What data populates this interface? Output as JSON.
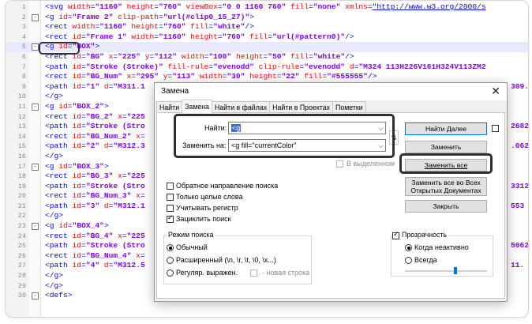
{
  "editor": {
    "lines": [
      {
        "n": "1",
        "segs": [
          [
            "tag",
            "<svg "
          ],
          [
            "attr",
            "width"
          ],
          [
            "tag",
            "="
          ],
          [
            "val",
            "\"1160\""
          ],
          [
            "tag",
            " "
          ],
          [
            "attr",
            "height"
          ],
          [
            "tag",
            "="
          ],
          [
            "val",
            "\"760\""
          ],
          [
            "tag",
            " "
          ],
          [
            "attr",
            "viewBox"
          ],
          [
            "tag",
            "="
          ],
          [
            "val",
            "\"0 0 1160 760\""
          ],
          [
            "tag",
            " "
          ],
          [
            "attr",
            "fill"
          ],
          [
            "tag",
            "="
          ],
          [
            "val",
            "\"none\""
          ],
          [
            "tag",
            " "
          ],
          [
            "attr",
            "xmlns"
          ],
          [
            "tag",
            "="
          ],
          [
            "url",
            "\"http://www.w3.org/2000/s"
          ]
        ]
      },
      {
        "n": "2",
        "fold": "-",
        "segs": [
          [
            "tag",
            "<g "
          ],
          [
            "attr",
            "id"
          ],
          [
            "tag",
            "="
          ],
          [
            "val",
            "\"Frame 2\""
          ],
          [
            "tag",
            " "
          ],
          [
            "attr",
            "clip-path"
          ],
          [
            "tag",
            "="
          ],
          [
            "val",
            "\"url(#clip0_15_27)\""
          ],
          [
            "tag",
            ">"
          ]
        ]
      },
      {
        "n": "3",
        "segs": [
          [
            "tag",
            "<rect "
          ],
          [
            "attr",
            "width"
          ],
          [
            "tag",
            "="
          ],
          [
            "val",
            "\"1160\""
          ],
          [
            "tag",
            " "
          ],
          [
            "attr",
            "height"
          ],
          [
            "tag",
            "="
          ],
          [
            "val",
            "\"760\""
          ],
          [
            "tag",
            " "
          ],
          [
            "attr",
            "fill"
          ],
          [
            "tag",
            "="
          ],
          [
            "val",
            "\"white\""
          ],
          [
            "tag",
            "/>"
          ]
        ]
      },
      {
        "n": "4",
        "segs": [
          [
            "tag",
            "<rect "
          ],
          [
            "attr",
            "id"
          ],
          [
            "tag",
            "="
          ],
          [
            "val",
            "\"Frame 1\""
          ],
          [
            "tag",
            " "
          ],
          [
            "attr",
            "width"
          ],
          [
            "tag",
            "="
          ],
          [
            "val",
            "\"1160\""
          ],
          [
            "tag",
            " "
          ],
          [
            "attr",
            "height"
          ],
          [
            "tag",
            "="
          ],
          [
            "val",
            "\"760\""
          ],
          [
            "tag",
            " "
          ],
          [
            "attr",
            "fill"
          ],
          [
            "tag",
            "="
          ],
          [
            "val",
            "\"url(#pattern0)\""
          ],
          [
            "tag",
            "/>"
          ]
        ]
      },
      {
        "n": "5",
        "fold": "-",
        "hl": true,
        "segs": [
          [
            "tag",
            "<g "
          ],
          [
            "attr",
            "id"
          ],
          [
            "tag",
            "="
          ],
          [
            "val",
            "\"BOX\""
          ],
          [
            "tag",
            ">"
          ]
        ]
      },
      {
        "n": "6",
        "segs": [
          [
            "tag",
            "<rect "
          ],
          [
            "attr",
            "id"
          ],
          [
            "tag",
            "="
          ],
          [
            "val",
            "\"BG\""
          ],
          [
            "tag",
            " "
          ],
          [
            "attr",
            "x"
          ],
          [
            "tag",
            "="
          ],
          [
            "val",
            "\"225\""
          ],
          [
            "tag",
            " "
          ],
          [
            "attr",
            "y"
          ],
          [
            "tag",
            "="
          ],
          [
            "val",
            "\"112\""
          ],
          [
            "tag",
            " "
          ],
          [
            "attr",
            "width"
          ],
          [
            "tag",
            "="
          ],
          [
            "val",
            "\"100\""
          ],
          [
            "tag",
            " "
          ],
          [
            "attr",
            "height"
          ],
          [
            "tag",
            "="
          ],
          [
            "val",
            "\"50\""
          ],
          [
            "tag",
            " "
          ],
          [
            "attr",
            "fill"
          ],
          [
            "tag",
            "="
          ],
          [
            "val",
            "\"white\""
          ],
          [
            "tag",
            "/>"
          ]
        ]
      },
      {
        "n": "7",
        "segs": [
          [
            "tag",
            "<path "
          ],
          [
            "attr",
            "id"
          ],
          [
            "tag",
            "="
          ],
          [
            "val",
            "\"Stroke (Stroke)\""
          ],
          [
            "tag",
            " "
          ],
          [
            "attr",
            "fill-rule"
          ],
          [
            "tag",
            "="
          ],
          [
            "val",
            "\"evenodd\""
          ],
          [
            "tag",
            " "
          ],
          [
            "attr",
            "clip-rule"
          ],
          [
            "tag",
            "="
          ],
          [
            "val",
            "\"evenodd\""
          ],
          [
            "tag",
            " "
          ],
          [
            "attr",
            "d"
          ],
          [
            "tag",
            "="
          ],
          [
            "val",
            "\"M324 113H226V161H324V113ZM2"
          ]
        ]
      },
      {
        "n": "8",
        "segs": [
          [
            "tag",
            "<rect "
          ],
          [
            "attr",
            "id"
          ],
          [
            "tag",
            "="
          ],
          [
            "val",
            "\"BG_Num\""
          ],
          [
            "tag",
            " "
          ],
          [
            "attr",
            "x"
          ],
          [
            "tag",
            "="
          ],
          [
            "val",
            "\"295\""
          ],
          [
            "tag",
            " "
          ],
          [
            "attr",
            "y"
          ],
          [
            "tag",
            "="
          ],
          [
            "val",
            "\"113\""
          ],
          [
            "tag",
            " "
          ],
          [
            "attr",
            "width"
          ],
          [
            "tag",
            "="
          ],
          [
            "val",
            "\"30\""
          ],
          [
            "tag",
            " "
          ],
          [
            "attr",
            "height"
          ],
          [
            "tag",
            "="
          ],
          [
            "val",
            "\"22\""
          ],
          [
            "tag",
            " "
          ],
          [
            "attr",
            "fill"
          ],
          [
            "tag",
            "="
          ],
          [
            "val",
            "\"#555555\""
          ],
          [
            "tag",
            "/>"
          ]
        ]
      },
      {
        "n": "9",
        "segs": [
          [
            "tag",
            "<path "
          ],
          [
            "attr",
            "id"
          ],
          [
            "tag",
            "="
          ],
          [
            "val",
            "\"1\""
          ],
          [
            "tag",
            " "
          ],
          [
            "attr",
            "d"
          ],
          [
            "tag",
            "="
          ],
          [
            "val",
            "\"M311.1"
          ]
        ],
        "tail": "309."
      },
      {
        "n": "10",
        "segs": [
          [
            "tag",
            "</g>"
          ]
        ]
      },
      {
        "n": "11",
        "fold": "-",
        "segs": [
          [
            "tag",
            "<g "
          ],
          [
            "attr",
            "id"
          ],
          [
            "tag",
            "="
          ],
          [
            "val",
            "\"BOX_2\""
          ],
          [
            "tag",
            ">"
          ]
        ]
      },
      {
        "n": "12",
        "segs": [
          [
            "tag",
            "<rect "
          ],
          [
            "attr",
            "id"
          ],
          [
            "tag",
            "="
          ],
          [
            "val",
            "\"BG_2\""
          ],
          [
            "tag",
            " "
          ],
          [
            "attr",
            "x"
          ],
          [
            "tag",
            "="
          ],
          [
            "val",
            "\"225"
          ]
        ]
      },
      {
        "n": "13",
        "segs": [
          [
            "tag",
            "<path "
          ],
          [
            "attr",
            "id"
          ],
          [
            "tag",
            "="
          ],
          [
            "val",
            "\"Stroke (Stro"
          ]
        ],
        "tail": "2682"
      },
      {
        "n": "14",
        "segs": [
          [
            "tag",
            "<rect "
          ],
          [
            "attr",
            "id"
          ],
          [
            "tag",
            "="
          ],
          [
            "val",
            "\"BG_Num_2\""
          ],
          [
            "tag",
            " "
          ],
          [
            "attr",
            "x"
          ],
          [
            "tag",
            "="
          ]
        ]
      },
      {
        "n": "15",
        "segs": [
          [
            "tag",
            "<path "
          ],
          [
            "attr",
            "id"
          ],
          [
            "tag",
            "="
          ],
          [
            "val",
            "\"2\""
          ],
          [
            "tag",
            " "
          ],
          [
            "attr",
            "d"
          ],
          [
            "tag",
            "="
          ],
          [
            "val",
            "\"M312.3"
          ]
        ],
        "tail": ".062"
      },
      {
        "n": "16",
        "segs": [
          [
            "tag",
            "</g>"
          ]
        ]
      },
      {
        "n": "17",
        "fold": "-",
        "segs": [
          [
            "tag",
            "<g "
          ],
          [
            "attr",
            "id"
          ],
          [
            "tag",
            "="
          ],
          [
            "val",
            "\"BOX_3\""
          ],
          [
            "tag",
            ">"
          ]
        ]
      },
      {
        "n": "18",
        "segs": [
          [
            "tag",
            "<rect "
          ],
          [
            "attr",
            "id"
          ],
          [
            "tag",
            "="
          ],
          [
            "val",
            "\"BG_3\""
          ],
          [
            "tag",
            " "
          ],
          [
            "attr",
            "x"
          ],
          [
            "tag",
            "="
          ],
          [
            "val",
            "\"225"
          ]
        ]
      },
      {
        "n": "19",
        "segs": [
          [
            "tag",
            "<path "
          ],
          [
            "attr",
            "id"
          ],
          [
            "tag",
            "="
          ],
          [
            "val",
            "\"Stroke (Stro"
          ]
        ],
        "tail": "3312"
      },
      {
        "n": "20",
        "segs": [
          [
            "tag",
            "<rect "
          ],
          [
            "attr",
            "id"
          ],
          [
            "tag",
            "="
          ],
          [
            "val",
            "\"BG_Num_3\""
          ],
          [
            "tag",
            " "
          ],
          [
            "attr",
            "x"
          ],
          [
            "tag",
            "="
          ]
        ]
      },
      {
        "n": "21",
        "segs": [
          [
            "tag",
            "<path "
          ],
          [
            "attr",
            "id"
          ],
          [
            "tag",
            "="
          ],
          [
            "val",
            "\"3\""
          ],
          [
            "tag",
            " "
          ],
          [
            "attr",
            "d"
          ],
          [
            "tag",
            "="
          ],
          [
            "val",
            "\"M312.1"
          ]
        ],
        "tail": "553"
      },
      {
        "n": "22",
        "segs": [
          [
            "tag",
            "</g>"
          ]
        ]
      },
      {
        "n": "23",
        "fold": "-",
        "segs": [
          [
            "tag",
            "<g "
          ],
          [
            "attr",
            "id"
          ],
          [
            "tag",
            "="
          ],
          [
            "val",
            "\"BOX_4\""
          ],
          [
            "tag",
            ">"
          ]
        ]
      },
      {
        "n": "24",
        "segs": [
          [
            "tag",
            "<rect "
          ],
          [
            "attr",
            "id"
          ],
          [
            "tag",
            "="
          ],
          [
            "val",
            "\"BG_4\""
          ],
          [
            "tag",
            " "
          ],
          [
            "attr",
            "x"
          ],
          [
            "tag",
            "="
          ],
          [
            "val",
            "\"225"
          ]
        ]
      },
      {
        "n": "25",
        "segs": [
          [
            "tag",
            "<path "
          ],
          [
            "attr",
            "id"
          ],
          [
            "tag",
            "="
          ],
          [
            "val",
            "\"Stroke (Stro"
          ]
        ],
        "tail": "5062"
      },
      {
        "n": "26",
        "segs": [
          [
            "tag",
            "<rect "
          ],
          [
            "attr",
            "id"
          ],
          [
            "tag",
            "="
          ],
          [
            "val",
            "\"BG_Num_4\""
          ],
          [
            "tag",
            " "
          ],
          [
            "attr",
            "x"
          ],
          [
            "tag",
            "="
          ]
        ]
      },
      {
        "n": "27",
        "segs": [
          [
            "tag",
            "<path "
          ],
          [
            "attr",
            "id"
          ],
          [
            "tag",
            "="
          ],
          [
            "val",
            "\"4\""
          ],
          [
            "tag",
            " "
          ],
          [
            "attr",
            "d"
          ],
          [
            "tag",
            "="
          ],
          [
            "val",
            "\"M312.5"
          ]
        ],
        "tail": "11."
      },
      {
        "n": "28",
        "segs": [
          [
            "tag",
            "</g>"
          ]
        ]
      },
      {
        "n": "29",
        "segs": [
          [
            "tag",
            "</g>"
          ]
        ]
      },
      {
        "n": "30",
        "fold": "-",
        "segs": [
          [
            "tag",
            "<defs>"
          ]
        ]
      }
    ]
  },
  "dialog": {
    "title": "Замена",
    "tabs": [
      "Найти",
      "Замена",
      "Найти в файлах",
      "Найти в Проектах",
      "Пометки"
    ],
    "find_label": "Найти:",
    "find_value": "<g",
    "replace_label": "Заменить на:",
    "replace_value": "<g fill=\"currentColor\"",
    "in_selection": "В выделенном",
    "find_next": "Найти Далее",
    "replace": "Заменить",
    "replace_all": "Заменить все",
    "replace_all_open_1": "Заменить все во Всех",
    "replace_all_open_2": "Открытых Документах",
    "close_btn": "Закрыть",
    "options": {
      "backward": "Обратное направление поиска",
      "whole_word": "Только целые слова",
      "match_case": "Учитывать регистр",
      "wrap": "Зациклить поиск"
    },
    "search_mode": {
      "legend": "Режим поиска",
      "normal": "Обычный",
      "extended": "Расширенный (\\n, \\r, \\t, \\0, \\x...)",
      "regex": "Регуляр. выражен.",
      "newline": ". - новая строка"
    },
    "transparency": {
      "legend": "Прозрачность",
      "on_lose_focus": "Когда неактивно",
      "always": "Всегда"
    },
    "scroll_glyph": "^",
    "swap_glyph": "⇅",
    "colors": {
      "accent": "#0078d7",
      "selection": "#3f6ed1",
      "outline": "#303030"
    }
  }
}
